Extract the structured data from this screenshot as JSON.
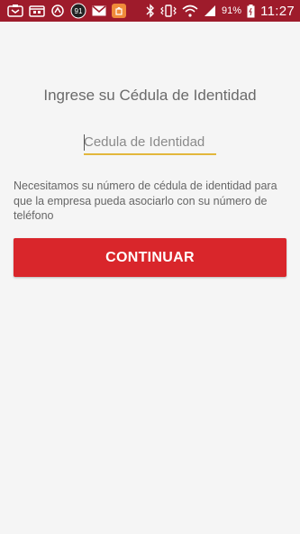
{
  "status_bar": {
    "time": "11:27",
    "battery_percent": "91%",
    "color": "#9e1b2b",
    "icons": [
      "app-notification-icon",
      "calendar-icon",
      "sync-icon",
      "counter-badge-icon",
      "mail-icon",
      "store-app-icon",
      "bluetooth-icon",
      "vibrate-icon",
      "wifi-icon",
      "signal-icon",
      "battery-icon"
    ],
    "counter_badge": "91"
  },
  "screen": {
    "title": "Ingrese su Cédula de Identidad",
    "id_field": {
      "placeholder": "Cedula de Identidad",
      "value": ""
    },
    "help_text": "Necesitamos su número de cédula de identidad para que la empresa pueda asociarlo con su número de teléfono",
    "continue_button": "CONTINUAR",
    "accent_color": "#d9262b",
    "field_underline_color": "#e2b73c"
  }
}
